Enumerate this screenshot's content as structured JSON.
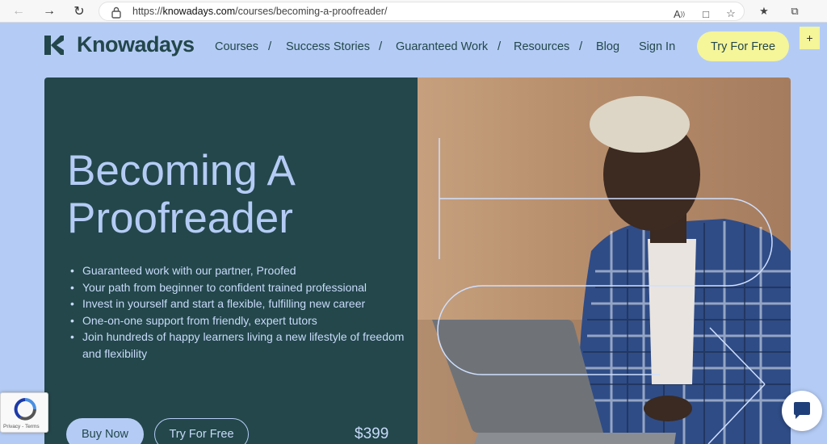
{
  "browser": {
    "url_prefix": "https://",
    "url_host": "knowadays.com",
    "url_path": "/courses/becoming-a-proofreader/"
  },
  "header": {
    "logo_text": "Knowadays",
    "nav": [
      "Courses",
      "Success Stories",
      "Guaranteed Work",
      "Resources",
      "Blog"
    ],
    "separator": "/",
    "sign_in": "Sign In",
    "cta": "Try For Free",
    "plus_label": "+"
  },
  "hero": {
    "title_line1": "Becoming A",
    "title_line2": "Proofreader",
    "bullets": [
      "Guaranteed work with our partner, Proofed",
      "Your path from beginner to confident trained professional",
      "Invest in yourself and start a flexible, fulfilling new career",
      "One-on-one support from friendly, expert tutors",
      "Join hundreds of happy learners living a new lifestyle of freedom and flexibility"
    ],
    "buy_label": "Buy Now",
    "try_label": "Try For Free",
    "price": "$399"
  },
  "recaptcha": {
    "terms": "Privacy - Terms"
  },
  "colors": {
    "page_bg": "#b4ccf5",
    "hero_dark": "#23474b",
    "accent_yellow": "#f5f59a",
    "accent_blue": "#b4ccf5"
  }
}
